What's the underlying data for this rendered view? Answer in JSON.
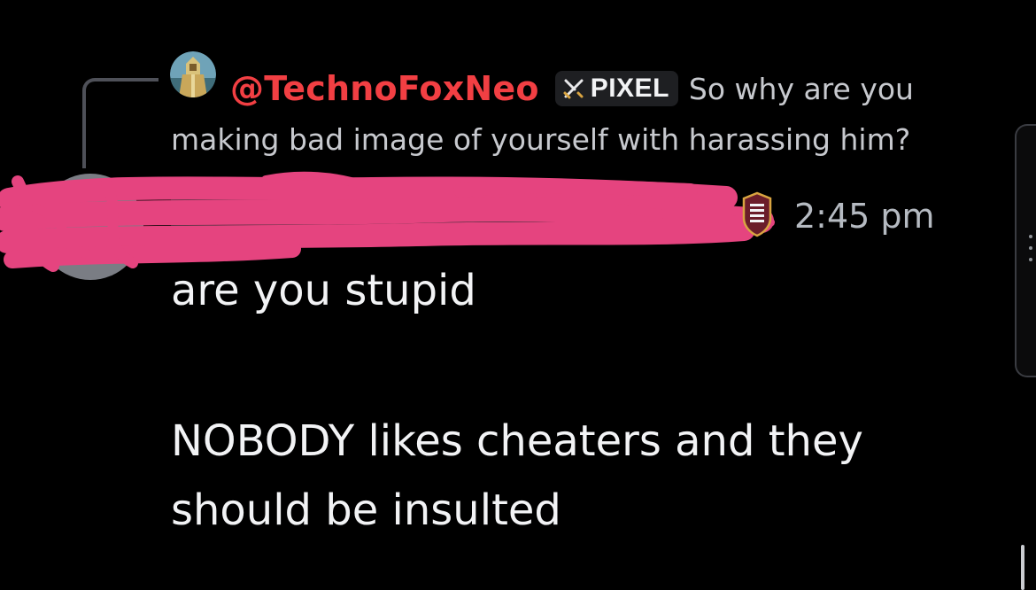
{
  "reply": {
    "username": "@TechnoFoxNeo",
    "tag_label": "PIXEL",
    "text_line1": "So why are you",
    "text_line2": "making bad image of yourself with harassing him?",
    "avatar_icon": "knight-avatar-icon",
    "tag_icon": "crossed-swords-icon"
  },
  "author": {
    "name_redacted": true,
    "role_icon": "shield-badge-icon",
    "timestamp": "2:45 pm"
  },
  "message": {
    "line1": "are you stupid",
    "line2": "NOBODY likes cheaters and they",
    "line3": "should be insulted"
  },
  "colors": {
    "background": "#000000",
    "reply_username": "#f23f43",
    "redaction": "#e5447f",
    "body_text": "#f2f3f5",
    "muted_text": "#b5bac1"
  }
}
